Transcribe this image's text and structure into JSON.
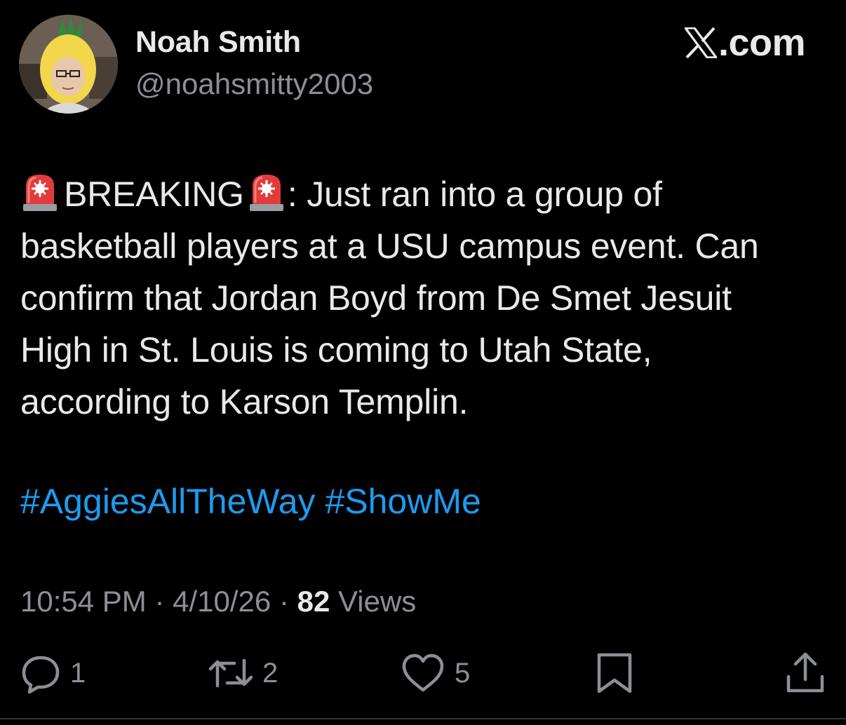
{
  "author": {
    "display_name": "Noah Smith",
    "handle": "@noahsmitty2003",
    "avatar_icon": "avatar-pineapple-hat"
  },
  "brand": {
    "label": ".com",
    "icon": "x-logo-icon"
  },
  "tweet": {
    "segments": {
      "breaking_label": "BREAKING",
      "after_breaking": ": Just ran into a group of",
      "line2": "basketball players at a USU campus event. Can",
      "line3": "confirm that Jordan Boyd from De Smet Jesuit",
      "line4": "High in St. Louis is coming to Utah State,",
      "line5": "according to Karson Templin."
    },
    "emoji_icon": "police-siren-icon",
    "hashtags": [
      "#AggiesAllTheWay",
      "#ShowMe"
    ]
  },
  "meta": {
    "time": "10:54 PM",
    "separator": "·",
    "date": "4/10/26",
    "views_count": "82",
    "views_label": "Views"
  },
  "actions": {
    "reply": {
      "icon": "reply-icon",
      "count": "1"
    },
    "repost": {
      "icon": "repost-icon",
      "count": "2"
    },
    "like": {
      "icon": "heart-icon",
      "count": "5"
    },
    "bookmark": {
      "icon": "bookmark-icon"
    },
    "share": {
      "icon": "share-icon"
    }
  },
  "colors": {
    "background": "#000000",
    "text": "#e7e9ea",
    "secondary_text": "#8b9096",
    "hashtag": "#1d9bf0"
  }
}
